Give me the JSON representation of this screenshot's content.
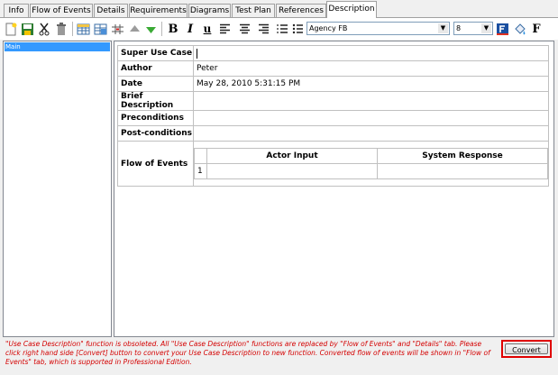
{
  "tabs": [
    {
      "label": "Info",
      "active": false
    },
    {
      "label": "Flow of Events",
      "active": false
    },
    {
      "label": "Details",
      "active": false
    },
    {
      "label": "Requirements",
      "active": false
    },
    {
      "label": "Diagrams",
      "active": false
    },
    {
      "label": "Test Plan",
      "active": false
    },
    {
      "label": "References",
      "active": false
    },
    {
      "label": "Description",
      "active": true
    }
  ],
  "toolbar": {
    "icons": [
      "new-document-icon",
      "save-icon",
      "cut-icon",
      "delete-icon",
      "insert-table-icon",
      "table-properties-icon",
      "split-cells-icon",
      "move-up-icon",
      "move-down-icon",
      "bold-icon",
      "italic-icon",
      "underline-icon",
      "align-left-icon",
      "align-center-icon",
      "align-right-icon",
      "numbered-list-icon",
      "bullet-list-icon",
      "font-color-icon",
      "fill-color-icon",
      "font-icon"
    ],
    "font_family": "Agency FB",
    "font_size": "8",
    "bold_glyph": "B",
    "italic_glyph": "I",
    "underline_glyph": "u",
    "font_glyph": "F"
  },
  "tree": {
    "selected_item": "Main"
  },
  "description": {
    "rows": [
      {
        "label": "Super Use Case",
        "value": ""
      },
      {
        "label": "Author",
        "value": "Peter"
      },
      {
        "label": "Date",
        "value": "May 28, 2010 5:31:15 PM"
      },
      {
        "label": "Brief Description",
        "value": ""
      },
      {
        "label": "Preconditions",
        "value": ""
      },
      {
        "label": "Post-conditions",
        "value": ""
      }
    ],
    "flow_of_events": {
      "label": "Flow of Events",
      "columns": [
        "Actor Input",
        "System Response"
      ],
      "rows": [
        {
          "number": "1",
          "actor_input": "",
          "system_response": ""
        }
      ]
    }
  },
  "notice": "\"Use Case Description\" function is obsoleted. All \"Use Case Description\" functions are replaced by \"Flow of Events\" and \"Details\" tab. Please click right hand side [Convert] button to convert your Use Case Description to new function. Converted flow of events will be shown in \"Flow of Events\" tab, which is supported in Professional Edition.",
  "convert_button": {
    "label": "Convert"
  },
  "colors": {
    "selection": "#3399ff",
    "notice_text": "#d40000",
    "convert_highlight": "#e00000"
  }
}
